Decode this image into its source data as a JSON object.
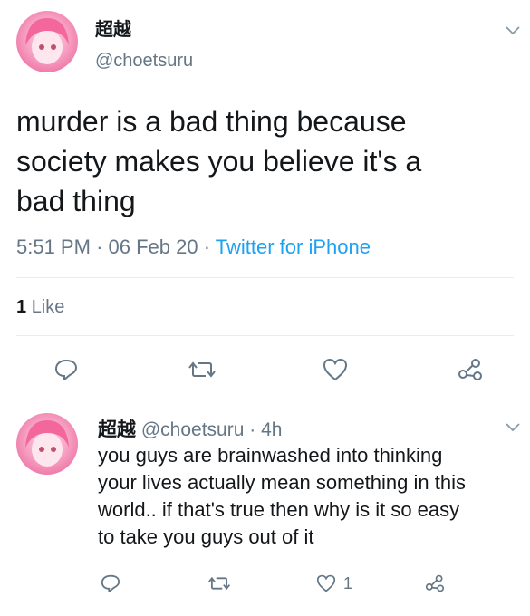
{
  "main_tweet": {
    "display_name": "超越",
    "handle": "@choetsuru",
    "text_lines": [
      "murder is a bad thing because",
      "society makes you believe it's a",
      "bad thing"
    ],
    "time": "5:51 PM",
    "date": "06 Feb 20",
    "sep": "·",
    "source": "Twitter for iPhone",
    "likes_count": "1",
    "likes_label": "Like",
    "actions": [
      "reply-icon",
      "retweet-icon",
      "like-icon",
      "share-icon"
    ]
  },
  "reply_tweet": {
    "display_name": "超越",
    "handle": "@choetsuru",
    "sep": "·",
    "age": "4h",
    "text_lines": [
      "you guys are brainwashed into thinking",
      "your lives actually mean something in this",
      "world.. if that's true then why is it so easy",
      "to take you guys out of it"
    ],
    "like_count": "1",
    "actions": [
      "reply-icon",
      "retweet-icon",
      "like-icon",
      "share-icon"
    ]
  },
  "colors": {
    "text": "#14171a",
    "muted": "#657786",
    "link": "#1da1f2",
    "divider": "#e6ecf0"
  }
}
